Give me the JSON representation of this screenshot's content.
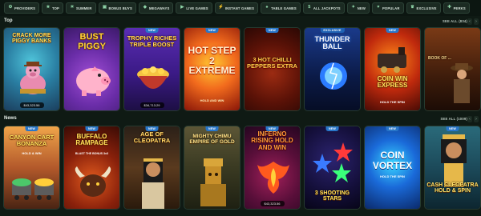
{
  "filters": [
    {
      "label": "PROVIDERS",
      "icon": "providers-icon",
      "glyph": "⚙"
    },
    {
      "label": "TOP",
      "icon": "star-icon",
      "glyph": "★"
    },
    {
      "label": "SUMMER",
      "icon": "sun-icon",
      "glyph": "☀"
    },
    {
      "label": "BONUS BUYS",
      "icon": "cart-icon",
      "glyph": "▣"
    },
    {
      "label": "MEGAWAYS",
      "icon": "megaways-icon",
      "glyph": "◆"
    },
    {
      "label": "LIVE GAMES",
      "icon": "live-icon",
      "glyph": "▶"
    },
    {
      "label": "INSTANT GAMES",
      "icon": "instant-icon",
      "glyph": "⚡"
    },
    {
      "label": "TABLE GAMES",
      "icon": "table-icon",
      "glyph": "♠"
    },
    {
      "label": "ALL JACKPOTS",
      "icon": "jackpot-icon",
      "glyph": "$"
    },
    {
      "label": "NEW",
      "icon": "new-icon",
      "glyph": "✦"
    },
    {
      "label": "POPULAR",
      "icon": "popular-icon",
      "glyph": "♥"
    },
    {
      "label": "EXCLUSIVE",
      "icon": "exclusive-icon",
      "glyph": "♛"
    },
    {
      "label": "PERKS",
      "icon": "perks-icon",
      "glyph": "✚"
    }
  ],
  "sections": {
    "top": {
      "title": "Top",
      "see_all": "SEE ALL (834)"
    },
    "news": {
      "title": "News",
      "see_all": "SEE ALL (1009)"
    }
  },
  "arrows": {
    "prev": "‹",
    "next": "›"
  },
  "top_games": [
    {
      "title": "CRACK MORE PIGGY BANKS",
      "badge": "",
      "jackpot": "$43,323.56"
    },
    {
      "title": "BUST PIGGY",
      "badge": "",
      "jackpot": ""
    },
    {
      "title": "TROPHY RICHES TRIPLE BOOST",
      "badge": "NEW",
      "jackpot": "$34,713.29"
    },
    {
      "title": "HOT STEP 2 EXTREME",
      "badge": "NEW",
      "jackpot": "",
      "sub": "HOLD AND WIN"
    },
    {
      "title": "3 HOT CHILLI PEPPERS EXTRA",
      "badge": "NEW",
      "jackpot": ""
    },
    {
      "title": "THUNDER BALL",
      "badge": "EXCLUSIVE",
      "jackpot": ""
    },
    {
      "title": "COIN WIN EXPRESS",
      "badge": "NEW",
      "jackpot": "",
      "sub": "HOLD THE SPIN"
    },
    {
      "title": "BOOK OF ...",
      "badge": "",
      "jackpot": ""
    }
  ],
  "new_games": [
    {
      "title": "CANYON CART BONANZA",
      "badge": "NEW",
      "jackpot": "",
      "sub": "HOLD & WIN"
    },
    {
      "title": "BUFFALO RAMPAGE",
      "badge": "NEW",
      "jackpot": "",
      "sub": "BLAST THE BONUS 3x3"
    },
    {
      "title": "AGE OF CLEOPATRA",
      "badge": "NEW",
      "jackpot": ""
    },
    {
      "title": "MIGHTY CHIMU EMPIRE OF GOLD",
      "badge": "NEW",
      "jackpot": ""
    },
    {
      "title": "INFERNO RISING HOLD AND WIN",
      "badge": "NEW",
      "jackpot": "$43,323.56"
    },
    {
      "title": "3 SHOOTING STARS",
      "badge": "NEW",
      "jackpot": ""
    },
    {
      "title": "COIN VORTEX",
      "badge": "NEW",
      "jackpot": "",
      "sub": "HOLD THE SPIN"
    },
    {
      "title": "CASH CLEOPATRA HOLD & SPIN",
      "badge": "NEW",
      "jackpot": ""
    }
  ]
}
